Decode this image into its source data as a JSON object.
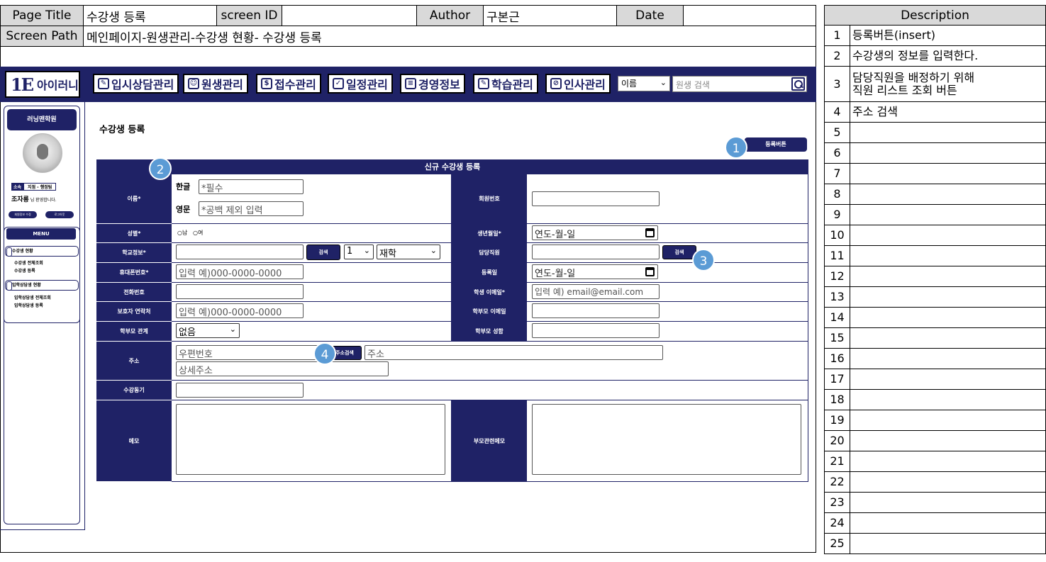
{
  "spec": {
    "page_title_label": "Page Title",
    "page_title_value": "수강생 등록",
    "screen_id_label": "screen ID",
    "screen_id_value": "",
    "author_label": "Author",
    "author_value": "구본근",
    "date_label": "Date",
    "date_value": "",
    "screen_path_label": "Screen Path",
    "screen_path_value": "메인페이지-원생관리-수강생 현황- 수강생 등록"
  },
  "description": {
    "header": "Description",
    "rows": [
      {
        "n": "1",
        "text": "등록버튼(insert)"
      },
      {
        "n": "2",
        "text": "수강생의 정보를 입력한다."
      },
      {
        "n": "3",
        "text": "담당직원을 배정하기 위해\n직원 리스트 조회 버튼"
      },
      {
        "n": "4",
        "text": "주소 검색"
      },
      {
        "n": "5",
        "text": ""
      },
      {
        "n": "6",
        "text": ""
      },
      {
        "n": "7",
        "text": ""
      },
      {
        "n": "8",
        "text": ""
      },
      {
        "n": "9",
        "text": ""
      },
      {
        "n": "10",
        "text": ""
      },
      {
        "n": "11",
        "text": ""
      },
      {
        "n": "12",
        "text": ""
      },
      {
        "n": "13",
        "text": ""
      },
      {
        "n": "14",
        "text": ""
      },
      {
        "n": "15",
        "text": ""
      },
      {
        "n": "16",
        "text": ""
      },
      {
        "n": "17",
        "text": ""
      },
      {
        "n": "18",
        "text": ""
      },
      {
        "n": "19",
        "text": ""
      },
      {
        "n": "20",
        "text": ""
      },
      {
        "n": "21",
        "text": ""
      },
      {
        "n": "22",
        "text": ""
      },
      {
        "n": "23",
        "text": ""
      },
      {
        "n": "24",
        "text": ""
      },
      {
        "n": "25",
        "text": ""
      }
    ]
  },
  "app": {
    "logo": {
      "mark": "1E",
      "text": "아이러니"
    },
    "nav": [
      {
        "label": "입시상담관리",
        "icon": "pencil-icon",
        "glyph": "✎"
      },
      {
        "label": "원생관리",
        "icon": "user-icon",
        "glyph": "☺"
      },
      {
        "label": "접수관리",
        "icon": "dollar-icon",
        "glyph": "$"
      },
      {
        "label": "일정관리",
        "icon": "calendar-check-icon",
        "glyph": "✓"
      },
      {
        "label": "경영정보",
        "icon": "document-icon",
        "glyph": "≡"
      },
      {
        "label": "학습관리",
        "icon": "edit-icon",
        "glyph": "✎"
      },
      {
        "label": "인사관리",
        "icon": "badge-icon",
        "glyph": "⊘"
      }
    ],
    "search_select": "이름",
    "search_placeholder": "원생 검색"
  },
  "sidebar": {
    "academy": "러닝맨학원",
    "role_tag": "소속",
    "role_value": "지점 - 행정팀",
    "user_name": "조자룡",
    "welcome_suffix": " 님 환영합니다.",
    "btn_edit": "회원정보 수정",
    "btn_logout": "로그아웃",
    "menu_title": "MENU",
    "groups": [
      {
        "label": "수강생 현황",
        "items": [
          "수강생 전체조회",
          "수강생 등록"
        ]
      },
      {
        "label": "입학상담생 현황",
        "items": [
          "입학상담생 전체조회",
          "입학상담생 등록"
        ]
      }
    ]
  },
  "main": {
    "heading": "수강생 등록",
    "register_button": "등록버튼",
    "form_title": "신규 수강생 등록",
    "labels": {
      "name": "이름*",
      "korean": "한글",
      "english": "영문",
      "member_no": "회원번호",
      "gender": "성별*",
      "birth": "생년월일*",
      "school": "학교정보*",
      "staff": "담당직원",
      "mobile": "휴대폰번호*",
      "reg_date": "등록일",
      "phone": "전화번호",
      "student_email": "학생 이메일*",
      "guardian_contact": "보호자 연락처",
      "parent_email": "학부모 이메일",
      "parent_relation": "학부모 관계",
      "parent_name": "학부모 성함",
      "address": "주소",
      "motive": "수강동기",
      "memo": "메모",
      "parent_memo": "부모관련메모"
    },
    "placeholders": {
      "korean": "*필수",
      "english": "*공백 제외 입력",
      "birth": "연도-월-일",
      "mobile": "입력 예)000-0000-0000",
      "reg_date": "연도-월-일",
      "student_email": "입력 예) email@email.com",
      "guardian_contact": "입력 예)000-0000-0000",
      "zipcode": "우편번호",
      "address": "주소",
      "address_detail": "상세주소"
    },
    "gender_options": [
      "○남",
      "○여"
    ],
    "grade_value": "1",
    "status_value": "재학",
    "relation_value": "없음",
    "search_label": "검색",
    "address_search_label": "주소검색"
  },
  "badges": [
    "1",
    "2",
    "3",
    "4"
  ],
  "colors": {
    "navy": "#1f2266",
    "badge": "#5b9bd5",
    "header_gray": "#d9d9d9"
  }
}
